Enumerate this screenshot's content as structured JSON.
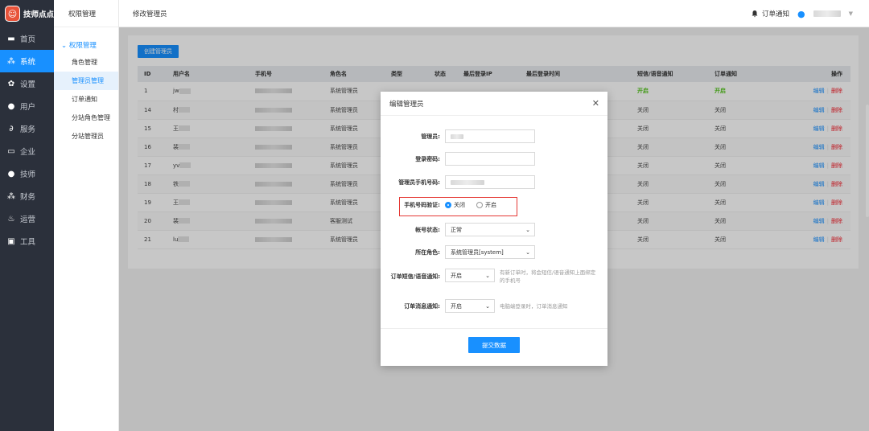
{
  "brand": {
    "name": "技师点点"
  },
  "nav": [
    {
      "label": "首页",
      "icon": "monitor-icon"
    },
    {
      "label": "系统",
      "icon": "sitemap-icon",
      "active": true
    },
    {
      "label": "设置",
      "icon": "gear-icon"
    },
    {
      "label": "用户",
      "icon": "user-icon"
    },
    {
      "label": "服务",
      "icon": "link-icon"
    },
    {
      "label": "企业",
      "icon": "building-icon"
    },
    {
      "label": "技师",
      "icon": "person-icon"
    },
    {
      "label": "财务",
      "icon": "sitemap-icon"
    },
    {
      "label": "运营",
      "icon": "chart-icon"
    },
    {
      "label": "工具",
      "icon": "briefcase-icon"
    }
  ],
  "subnav": {
    "title": "权限管理",
    "group": "权限管理",
    "items": [
      {
        "label": "角色管理"
      },
      {
        "label": "管理员管理",
        "active": true
      },
      {
        "label": "订单通知"
      },
      {
        "label": "分站角色管理"
      },
      {
        "label": "分站管理员"
      }
    ]
  },
  "topbar": {
    "page_title": "修改管理员",
    "notify_label": "订单通知"
  },
  "create_button": "创建管理员",
  "table": {
    "headers": [
      "ID",
      "用户名",
      "手机号",
      "角色名",
      "类型",
      "状态",
      "最后登录IP",
      "最后登录时间",
      "短信/语音通知",
      "订单通知",
      "操作"
    ],
    "rows": [
      {
        "id": "1",
        "user": "jw",
        "role": "系统管理员",
        "sms": "开启",
        "order": "开启",
        "sms_on": true
      },
      {
        "id": "14",
        "user": "村",
        "role": "系统管理员",
        "sms": "关闭",
        "order": "关闭"
      },
      {
        "id": "15",
        "user": "王",
        "role": "系统管理员",
        "sms": "关闭",
        "order": "关闭"
      },
      {
        "id": "16",
        "user": "裴",
        "role": "系统管理员",
        "sms": "关闭",
        "order": "关闭"
      },
      {
        "id": "17",
        "user": "yv",
        "role": "系统管理员",
        "sms": "关闭",
        "order": "关闭"
      },
      {
        "id": "18",
        "user": "铁",
        "role": "系统管理员",
        "sms": "关闭",
        "order": "关闭"
      },
      {
        "id": "19",
        "user": "王",
        "role": "系统管理员",
        "sms": "关闭",
        "order": "关闭"
      },
      {
        "id": "20",
        "user": "裴",
        "role": "客服测试",
        "sms": "关闭",
        "order": "关闭"
      },
      {
        "id": "21",
        "user": "lu",
        "role": "系统管理员",
        "sms": "关闭",
        "order": "关闭"
      }
    ],
    "edit_label": "编辑",
    "delete_label": "删除"
  },
  "modal": {
    "title": "编辑管理员",
    "admin_label": "管理员:",
    "password_label": "登录密码:",
    "phone_label": "管理员手机号码:",
    "verify_label": "手机号码验证:",
    "verify_off": "关闭",
    "verify_on": "开启",
    "status_label": "帐号状态:",
    "status_value": "正常",
    "role_label": "所在角色:",
    "role_value": "系统管理员[system]",
    "sms_label": "订单短信/语音通知:",
    "sms_value": "开启",
    "sms_hint": "有新订单时，将会短信/语音通知上面绑定的手机号",
    "msg_label": "订单消息通知:",
    "msg_value": "开启",
    "msg_hint": "电脑端登录时，订单消息通知",
    "submit_label": "提交数据"
  }
}
